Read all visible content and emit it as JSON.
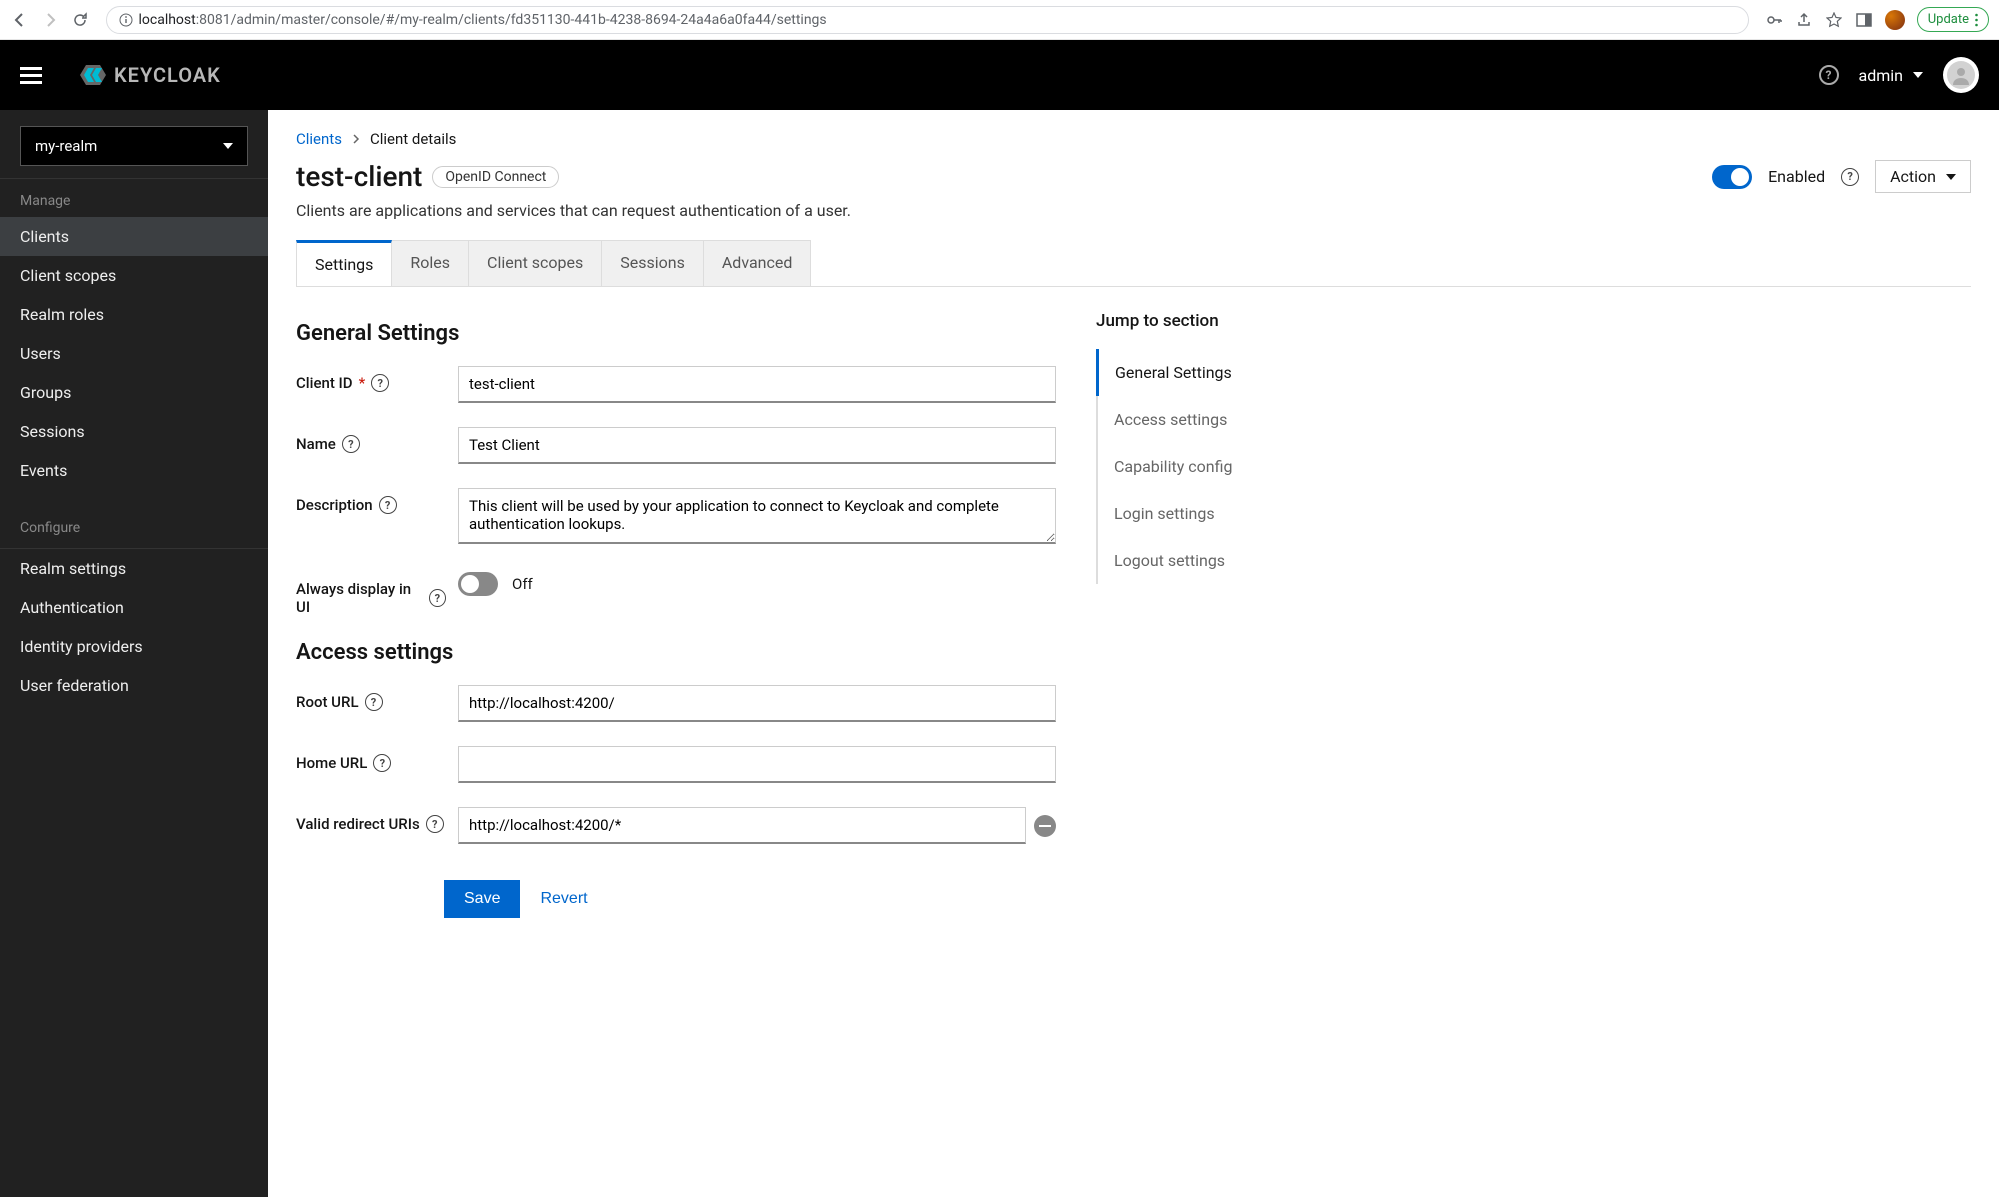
{
  "browser": {
    "url_host": "localhost",
    "url_path": ":8081/admin/master/console/#/my-realm/clients/fd351130-441b-4238-8694-24a4a6a0fa44/settings",
    "update_label": "Update"
  },
  "header": {
    "logo_text": "KEYCLOAK",
    "user_label": "admin"
  },
  "sidebar": {
    "realm_selected": "my-realm",
    "section_manage": "Manage",
    "section_configure": "Configure",
    "manage_items": [
      {
        "label": "Clients",
        "active": true
      },
      {
        "label": "Client scopes"
      },
      {
        "label": "Realm roles"
      },
      {
        "label": "Users"
      },
      {
        "label": "Groups"
      },
      {
        "label": "Sessions"
      },
      {
        "label": "Events"
      }
    ],
    "configure_items": [
      {
        "label": "Realm settings"
      },
      {
        "label": "Authentication"
      },
      {
        "label": "Identity providers"
      },
      {
        "label": "User federation"
      }
    ]
  },
  "breadcrumb": {
    "root": "Clients",
    "current": "Client details"
  },
  "page": {
    "title": "test-client",
    "protocol_badge": "OpenID Connect",
    "description": "Clients are applications and services that can request authentication of a user.",
    "enabled_label": "Enabled",
    "action_label": "Action"
  },
  "tabs": [
    {
      "label": "Settings",
      "active": true
    },
    {
      "label": "Roles"
    },
    {
      "label": "Client scopes"
    },
    {
      "label": "Sessions"
    },
    {
      "label": "Advanced"
    }
  ],
  "sections": {
    "general_title": "General Settings",
    "access_title": "Access settings"
  },
  "form": {
    "client_id_label": "Client ID",
    "client_id_value": "test-client",
    "name_label": "Name",
    "name_value": "Test Client",
    "description_label": "Description",
    "description_value": "This client will be used by your application to connect to Keycloak and complete authentication lookups.",
    "always_display_label": "Always display in UI",
    "always_display_state": "Off",
    "root_url_label": "Root URL",
    "root_url_value": "http://localhost:4200/",
    "home_url_label": "Home URL",
    "home_url_value": "",
    "valid_redirect_label": "Valid redirect URIs",
    "valid_redirect_value": "http://localhost:4200/*",
    "save_label": "Save",
    "revert_label": "Revert"
  },
  "jump": {
    "title": "Jump to section",
    "items": [
      {
        "label": "General Settings",
        "active": true
      },
      {
        "label": "Access settings"
      },
      {
        "label": "Capability config"
      },
      {
        "label": "Login settings"
      },
      {
        "label": "Logout settings"
      }
    ]
  }
}
